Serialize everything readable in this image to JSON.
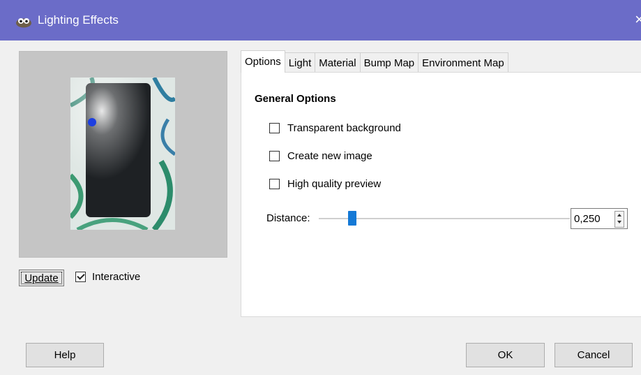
{
  "window": {
    "title": "Lighting Effects",
    "close_glyph": "×"
  },
  "preview": {
    "update_label": "Update",
    "interactive_label": "Interactive",
    "interactive_checked": true
  },
  "tabs": [
    {
      "label": "Options",
      "active": true
    },
    {
      "label": "Light",
      "active": false
    },
    {
      "label": "Material",
      "active": false
    },
    {
      "label": "Bump Map",
      "active": false
    },
    {
      "label": "Environment Map",
      "active": false
    }
  ],
  "options": {
    "section_title": "General Options",
    "transparent_background": {
      "label": "Transparent background",
      "checked": false
    },
    "create_new_image": {
      "label": "Create new image",
      "checked": false
    },
    "high_quality_preview": {
      "label": "High quality preview",
      "checked": false
    },
    "distance": {
      "label": "Distance:",
      "value": "0,250"
    }
  },
  "buttons": {
    "help": "Help",
    "ok": "OK",
    "cancel": "Cancel"
  },
  "colors": {
    "titlebar": "#6b6cc8",
    "accent": "#1479d6",
    "light_dot": "#1d3fe0"
  }
}
